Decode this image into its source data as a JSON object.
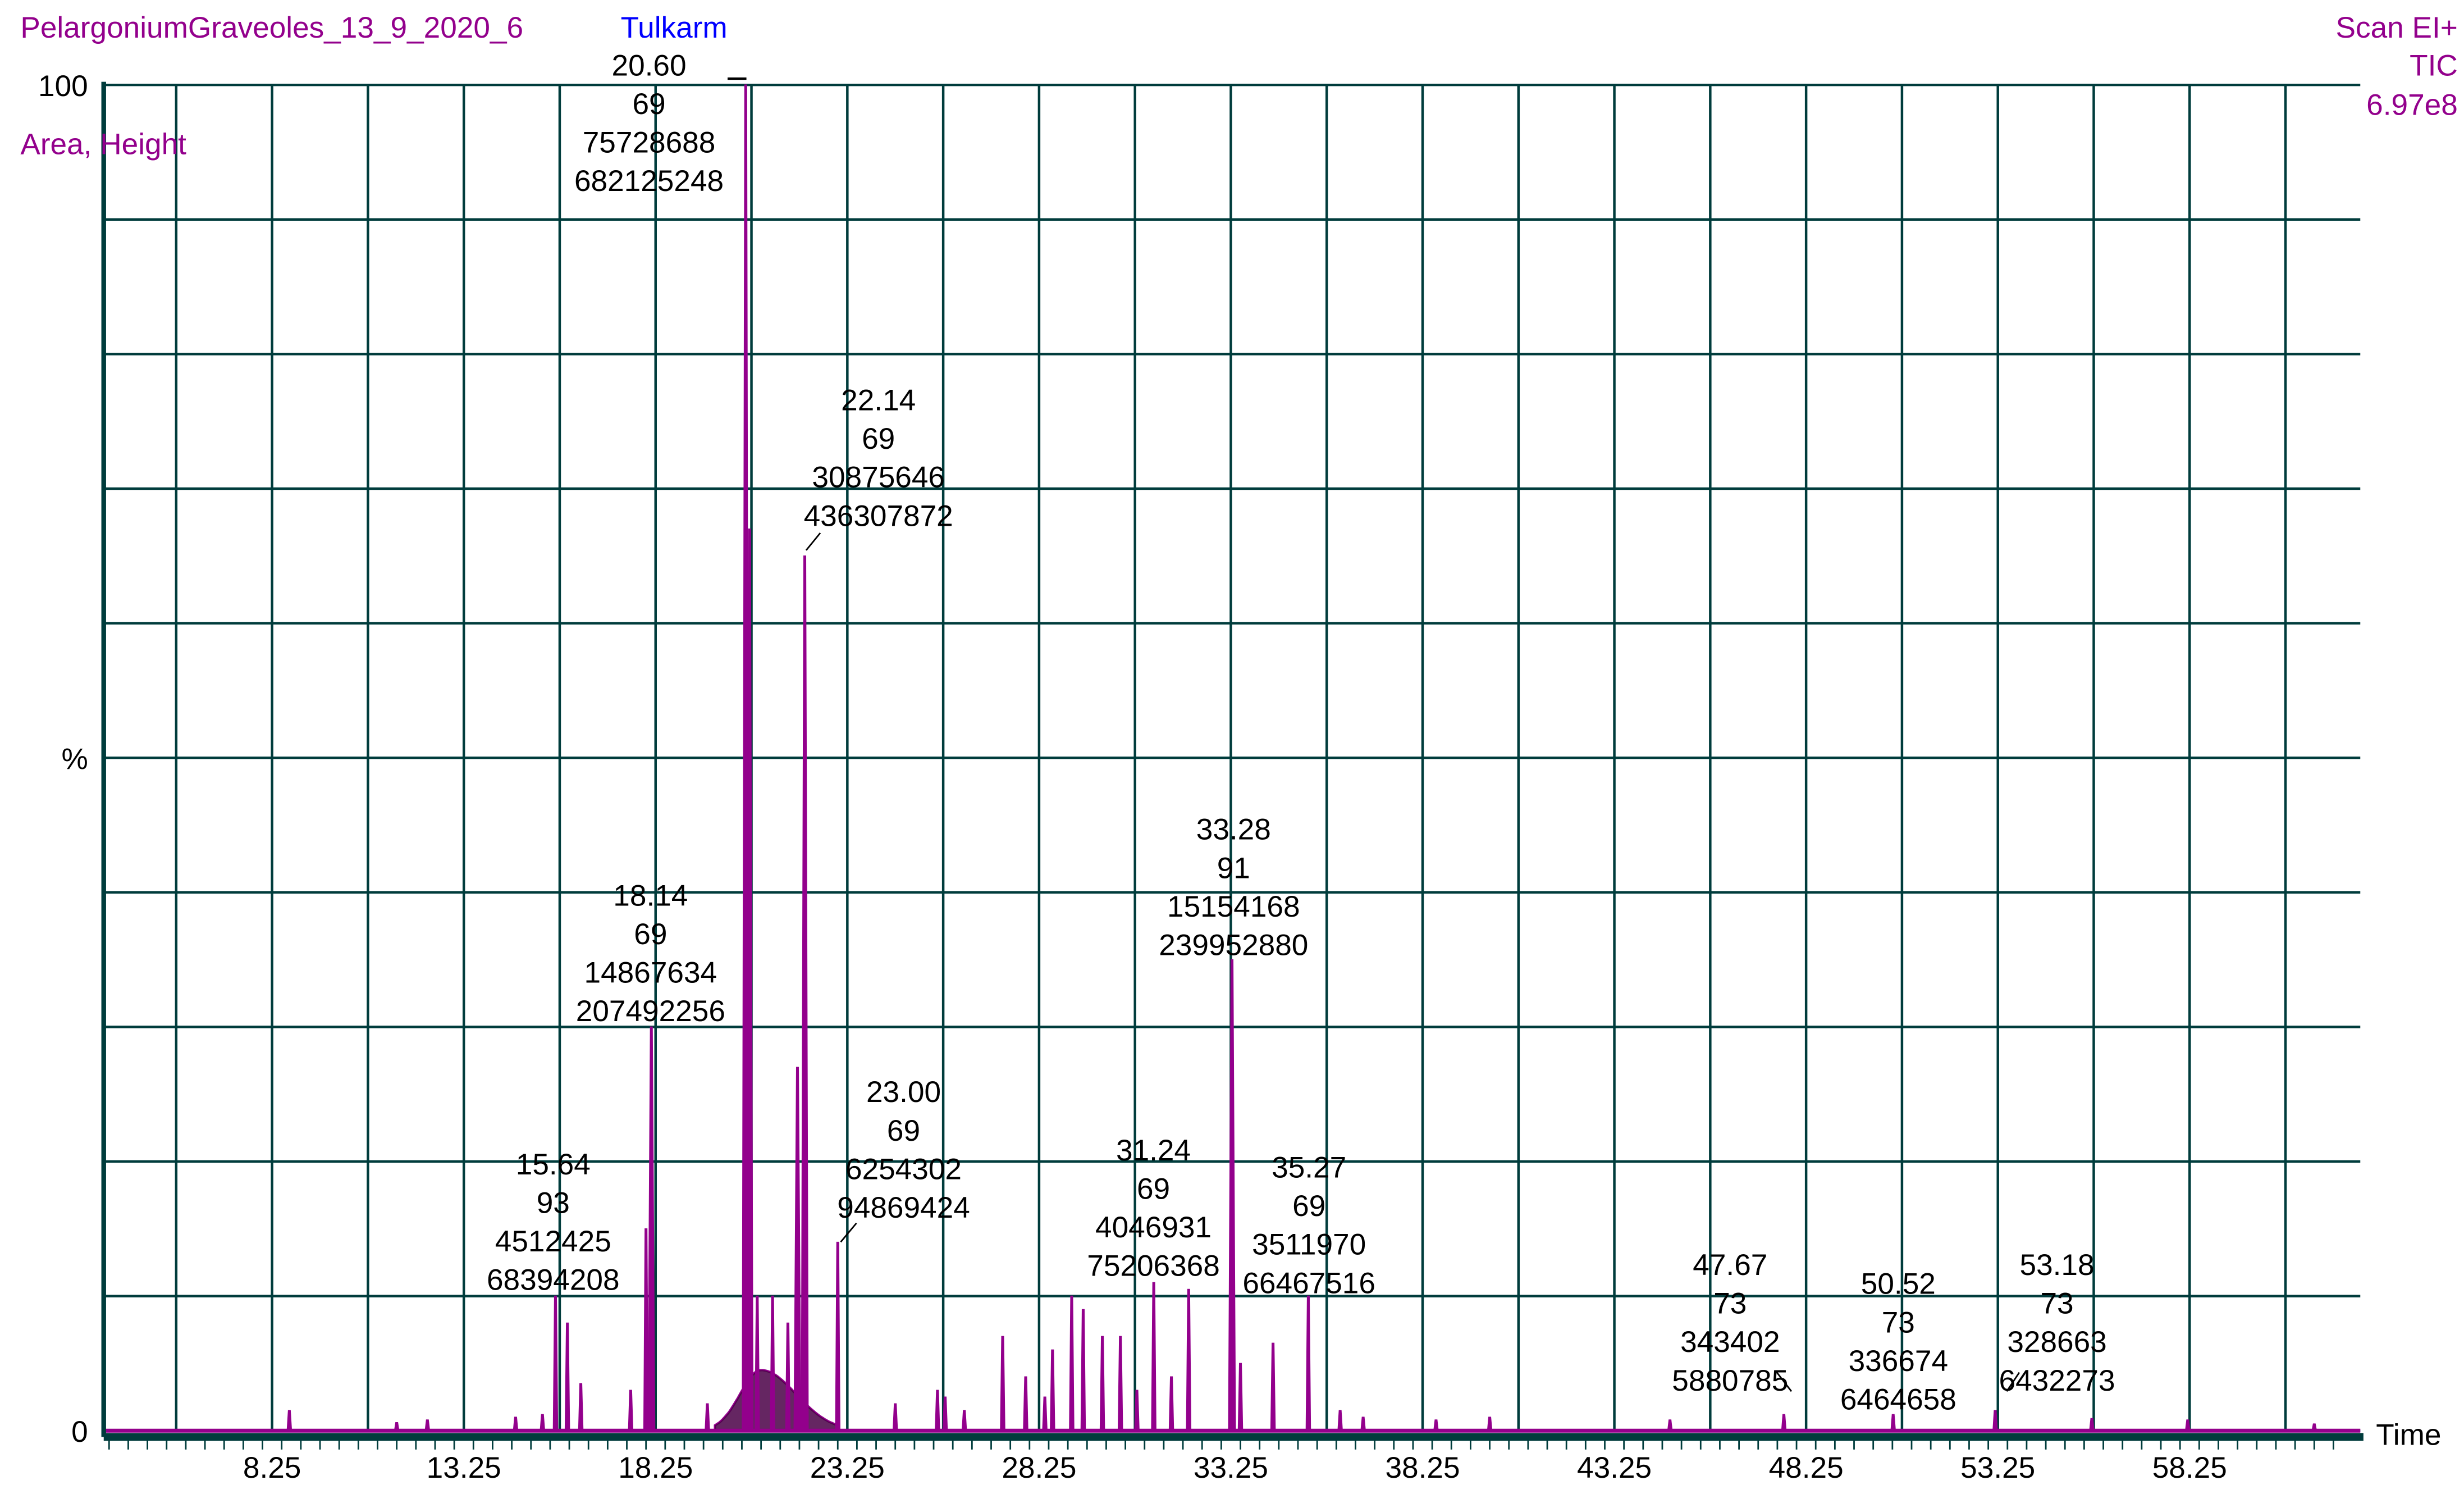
{
  "header": {
    "sample_name": "PelargoniumGraveoles_13_9_2020_6",
    "location": "Tulkarm",
    "scan_mode": "Scan EI+",
    "trace": "TIC",
    "max_intensity": "6.97e8",
    "label_format": "Area, Height"
  },
  "colors": {
    "trace": "#93008c",
    "grid": "#003c3c",
    "location": "#0000ff"
  },
  "chart_data": {
    "type": "line",
    "title": "PelargoniumGraveoles_13_9_2020_6 Tulkarm",
    "xlabel": "Time",
    "ylabel": "%",
    "xlim": [
      3.86,
      62.7
    ],
    "ylim": [
      0,
      100
    ],
    "grid": true,
    "x_ticks": [
      "8.25",
      "13.25",
      "18.25",
      "23.25",
      "28.25",
      "33.25",
      "38.25",
      "43.25",
      "48.25",
      "53.25",
      "58.25"
    ],
    "y_ticks": [
      "100",
      "%",
      "0"
    ],
    "labeled_peaks": [
      {
        "time": "20.60",
        "mass": "69",
        "height": "75728688",
        "area": "682125248",
        "percent": 100
      },
      {
        "time": "22.14",
        "mass": "69",
        "height": "30875646",
        "area": "436307872",
        "percent": 65
      },
      {
        "time": "18.14",
        "mass": "69",
        "height": "14867634",
        "area": "207492256",
        "percent": 30
      },
      {
        "time": "33.28",
        "mass": "91",
        "height": "15154168",
        "area": "239952880",
        "percent": 35
      },
      {
        "time": "15.64",
        "mass": "93",
        "height": "4512425",
        "area": "68394208",
        "percent": 10
      },
      {
        "time": "23.00",
        "mass": "69",
        "height": "6254302",
        "area": "94869424",
        "percent": 14
      },
      {
        "time": "31.24",
        "mass": "69",
        "height": "4046931",
        "area": "75206368",
        "percent": 11
      },
      {
        "time": "35.27",
        "mass": "69",
        "height": "3511970",
        "area": "66467516",
        "percent": 10
      },
      {
        "time": "47.67",
        "mass": "73",
        "height": "343402",
        "area": "5880785",
        "percent": 1.2
      },
      {
        "time": "50.52",
        "mass": "73",
        "height": "336674",
        "area": "6464658",
        "percent": 1.2
      },
      {
        "time": "53.18",
        "mass": "73",
        "height": "328663",
        "area": "6432273",
        "percent": 1.5
      }
    ],
    "minor_peaks": [
      [
        8.7,
        1.5
      ],
      [
        11.5,
        0.6
      ],
      [
        12.3,
        0.8
      ],
      [
        14.6,
        1
      ],
      [
        15.3,
        1.2
      ],
      [
        15.95,
        8
      ],
      [
        16.3,
        3.5
      ],
      [
        17.6,
        3
      ],
      [
        18.0,
        15
      ],
      [
        19.6,
        2
      ],
      [
        20.7,
        67
      ],
      [
        20.9,
        10
      ],
      [
        21.3,
        10
      ],
      [
        21.7,
        8
      ],
      [
        21.95,
        27
      ],
      [
        24.5,
        2
      ],
      [
        25.6,
        3
      ],
      [
        25.8,
        2.5
      ],
      [
        26.3,
        1.5
      ],
      [
        27.3,
        7
      ],
      [
        27.9,
        4
      ],
      [
        28.4,
        2.5
      ],
      [
        28.6,
        6
      ],
      [
        29.1,
        10
      ],
      [
        29.4,
        9
      ],
      [
        29.9,
        7
      ],
      [
        30.37,
        7
      ],
      [
        30.8,
        3
      ],
      [
        31.7,
        4
      ],
      [
        32.15,
        10.5
      ],
      [
        33.5,
        5
      ],
      [
        34.35,
        6.5
      ],
      [
        36.1,
        1.5
      ],
      [
        36.7,
        1
      ],
      [
        38.6,
        0.8
      ],
      [
        40.0,
        1
      ],
      [
        44.7,
        0.8
      ],
      [
        55.7,
        0.9
      ],
      [
        58.2,
        0.8
      ],
      [
        61.5,
        0.5
      ]
    ],
    "hump": {
      "start": 19.8,
      "peak": 21.0,
      "end": 23.0,
      "percent": 4.5
    }
  }
}
